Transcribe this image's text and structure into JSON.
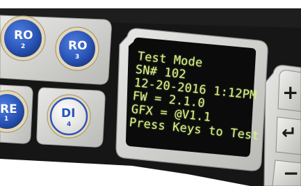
{
  "device": {
    "keys": [
      {
        "id": "ro2",
        "label": "RO",
        "number": "2"
      },
      {
        "id": "ro3",
        "label": "RO",
        "number": "3"
      },
      {
        "id": "re1",
        "label": "RE",
        "number": "1"
      },
      {
        "id": "di4",
        "label": "DI",
        "number": "4"
      }
    ],
    "display": {
      "lines": [
        "Test Mode",
        "SN# 102",
        "12-20-2016  1:12PM",
        "FW = 2.1.0",
        "GFX = @V1.1",
        "Press Keys to Test"
      ]
    },
    "nav_keys": [
      {
        "id": "plus",
        "symbol": "+",
        "icon": "plus-icon"
      },
      {
        "id": "enter",
        "symbol": "↵",
        "icon": "enter-icon"
      },
      {
        "id": "minus",
        "symbol": "−",
        "icon": "minus-icon"
      }
    ]
  },
  "colors": {
    "top_bar": "#2b4f9c",
    "key_blue": "#2a55b8",
    "key_ring": "#d9c9a3",
    "lcd_text": "#d9f08a",
    "lcd_background": "#0b0b0b",
    "panel_dark": "#151515",
    "bezel_grey": "#d7d7d4"
  }
}
